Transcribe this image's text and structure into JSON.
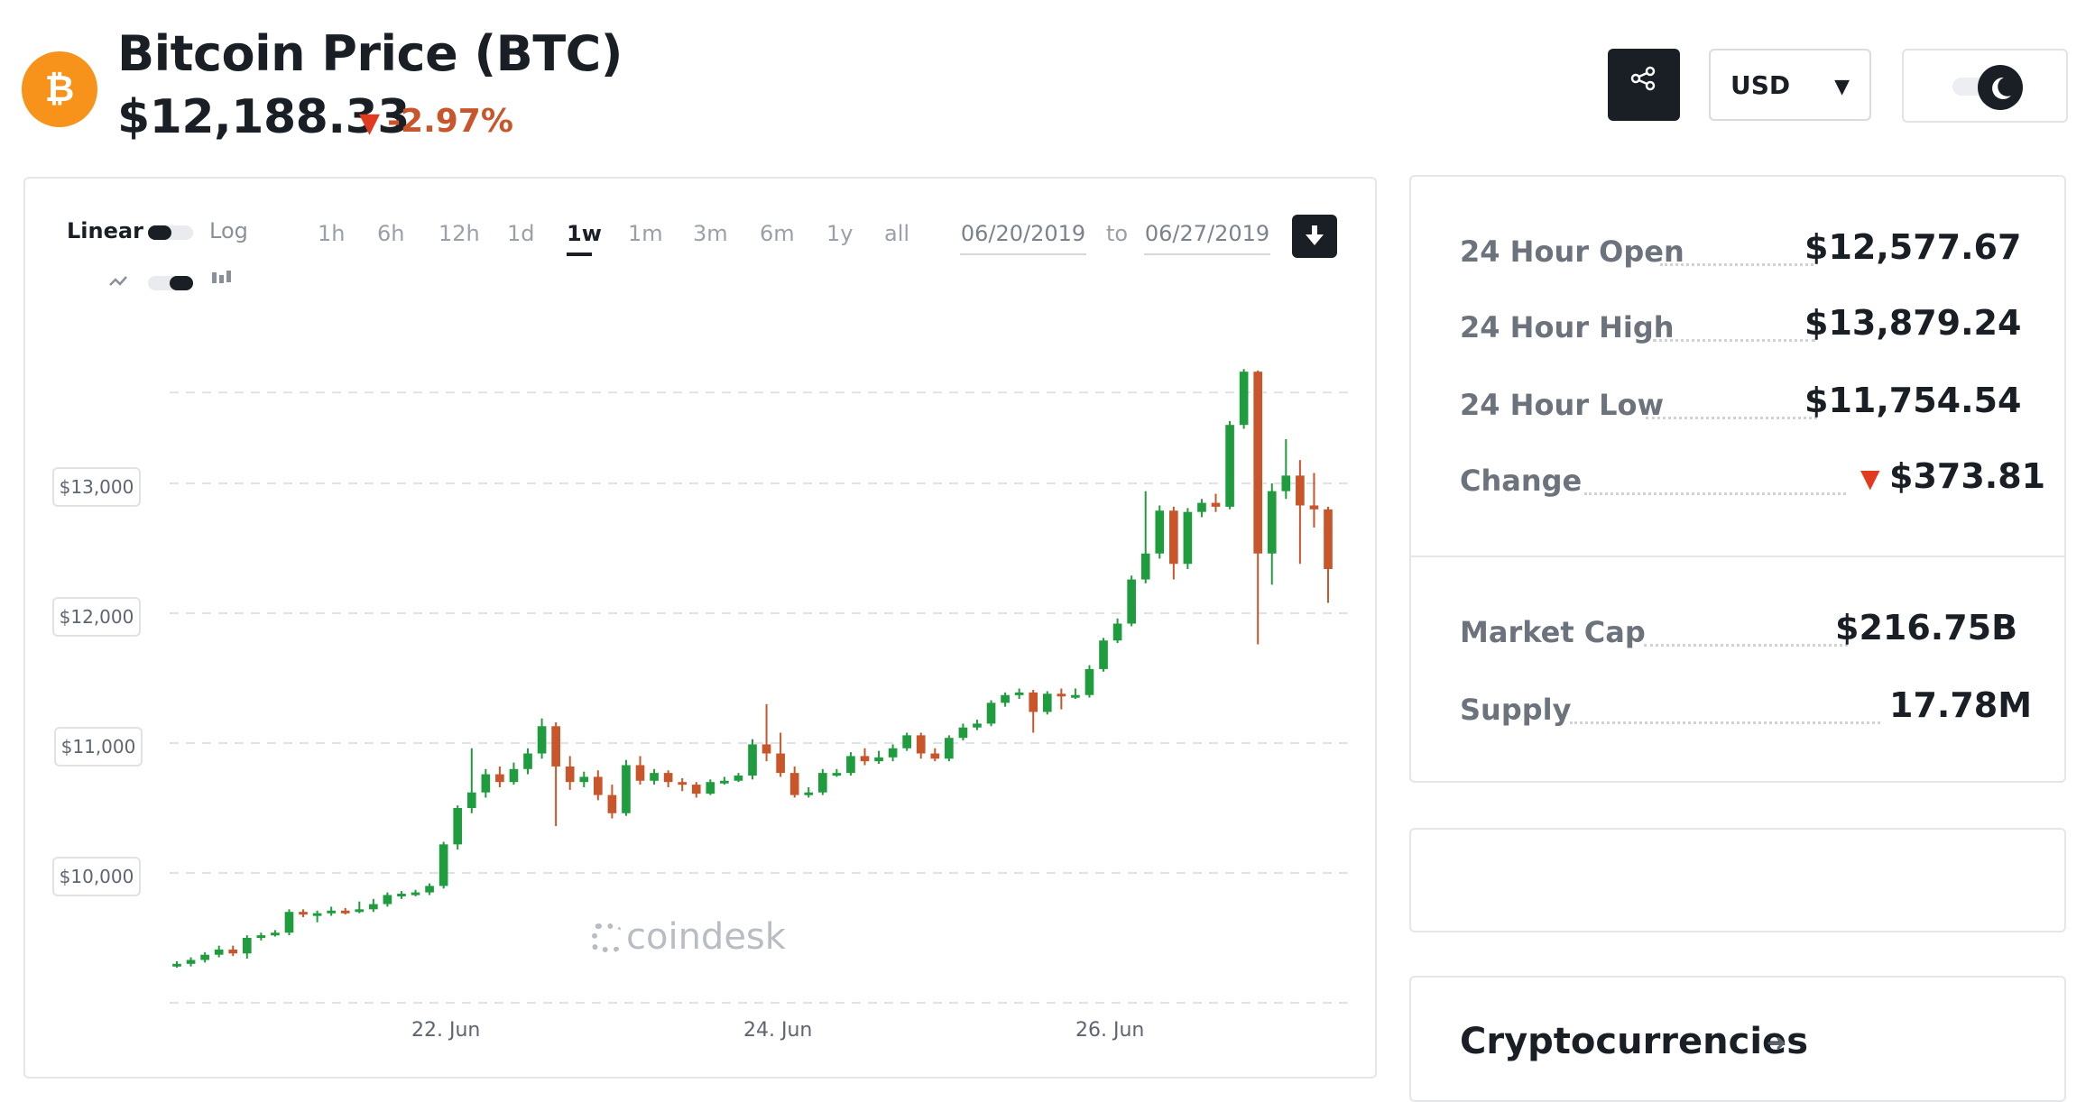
{
  "header": {
    "logo_icon": "bitcoin-logo-icon",
    "title": "Bitcoin Price (BTC)",
    "price": "$12,188.33",
    "change_pct": "-2.97%",
    "change_direction_icon": "down-triangle-icon"
  },
  "toolbar": {
    "share_icon": "share-icon",
    "currency": "USD",
    "theme_icon": "moon-icon"
  },
  "chart_controls": {
    "scale_linear": "Linear",
    "scale_log": "Log",
    "ranges": [
      "1h",
      "6h",
      "12h",
      "1d",
      "1w",
      "1m",
      "3m",
      "6m",
      "1y",
      "all"
    ],
    "active_range": "1w",
    "date_from": "06/20/2019",
    "date_to_label": "to",
    "date_to": "06/27/2019",
    "download_icon": "download-icon"
  },
  "chart_data": {
    "type": "candlestick",
    "ylabels": [
      "$13,000",
      "$12,000",
      "$11,000",
      "$10,000"
    ],
    "xlabels": [
      "22. Jun",
      "24. Jun",
      "26. Jun"
    ],
    "ylim": [
      9200,
      14200
    ],
    "up_color": "#1f9c3e",
    "down_color": "#c8562a",
    "watermark": "coindesk",
    "candles": [
      {
        "o": 9290,
        "c": 9300,
        "h": 9320,
        "l": 9270
      },
      {
        "o": 9300,
        "c": 9330,
        "h": 9350,
        "l": 9280
      },
      {
        "o": 9330,
        "c": 9370,
        "h": 9390,
        "l": 9310
      },
      {
        "o": 9370,
        "c": 9410,
        "h": 9440,
        "l": 9350
      },
      {
        "o": 9410,
        "c": 9380,
        "h": 9440,
        "l": 9360
      },
      {
        "o": 9380,
        "c": 9500,
        "h": 9520,
        "l": 9340
      },
      {
        "o": 9500,
        "c": 9520,
        "h": 9540,
        "l": 9480
      },
      {
        "o": 9520,
        "c": 9540,
        "h": 9560,
        "l": 9510
      },
      {
        "o": 9540,
        "c": 9700,
        "h": 9720,
        "l": 9520
      },
      {
        "o": 9700,
        "c": 9680,
        "h": 9720,
        "l": 9660
      },
      {
        "o": 9680,
        "c": 9690,
        "h": 9710,
        "l": 9620
      },
      {
        "o": 9690,
        "c": 9710,
        "h": 9740,
        "l": 9670
      },
      {
        "o": 9710,
        "c": 9700,
        "h": 9730,
        "l": 9680
      },
      {
        "o": 9700,
        "c": 9720,
        "h": 9780,
        "l": 9690
      },
      {
        "o": 9720,
        "c": 9760,
        "h": 9800,
        "l": 9700
      },
      {
        "o": 9760,
        "c": 9830,
        "h": 9850,
        "l": 9740
      },
      {
        "o": 9830,
        "c": 9840,
        "h": 9860,
        "l": 9800
      },
      {
        "o": 9840,
        "c": 9850,
        "h": 9870,
        "l": 9820
      },
      {
        "o": 9850,
        "c": 9900,
        "h": 9920,
        "l": 9830
      },
      {
        "o": 9900,
        "c": 10220,
        "h": 10240,
        "l": 9880
      },
      {
        "o": 10220,
        "c": 10500,
        "h": 10520,
        "l": 10180
      },
      {
        "o": 10500,
        "c": 10620,
        "h": 10960,
        "l": 10460
      },
      {
        "o": 10620,
        "c": 10760,
        "h": 10800,
        "l": 10580
      },
      {
        "o": 10760,
        "c": 10700,
        "h": 10820,
        "l": 10660
      },
      {
        "o": 10700,
        "c": 10800,
        "h": 10850,
        "l": 10680
      },
      {
        "o": 10800,
        "c": 10920,
        "h": 10960,
        "l": 10760
      },
      {
        "o": 10920,
        "c": 11130,
        "h": 11190,
        "l": 10880
      },
      {
        "o": 11130,
        "c": 10820,
        "h": 11160,
        "l": 10360
      },
      {
        "o": 10820,
        "c": 10700,
        "h": 10900,
        "l": 10640
      },
      {
        "o": 10700,
        "c": 10740,
        "h": 10780,
        "l": 10660
      },
      {
        "o": 10740,
        "c": 10600,
        "h": 10790,
        "l": 10560
      },
      {
        "o": 10600,
        "c": 10460,
        "h": 10680,
        "l": 10420
      },
      {
        "o": 10460,
        "c": 10830,
        "h": 10870,
        "l": 10440
      },
      {
        "o": 10830,
        "c": 10710,
        "h": 10900,
        "l": 10680
      },
      {
        "o": 10710,
        "c": 10770,
        "h": 10800,
        "l": 10680
      },
      {
        "o": 10770,
        "c": 10700,
        "h": 10790,
        "l": 10660
      },
      {
        "o": 10700,
        "c": 10680,
        "h": 10730,
        "l": 10630
      },
      {
        "o": 10680,
        "c": 10610,
        "h": 10700,
        "l": 10580
      },
      {
        "o": 10610,
        "c": 10700,
        "h": 10720,
        "l": 10600
      },
      {
        "o": 10700,
        "c": 10710,
        "h": 10740,
        "l": 10680
      },
      {
        "o": 10710,
        "c": 10750,
        "h": 10770,
        "l": 10700
      },
      {
        "o": 10750,
        "c": 10990,
        "h": 11030,
        "l": 10720
      },
      {
        "o": 10990,
        "c": 10920,
        "h": 11300,
        "l": 10860
      },
      {
        "o": 10920,
        "c": 10770,
        "h": 11080,
        "l": 10740
      },
      {
        "o": 10770,
        "c": 10600,
        "h": 10820,
        "l": 10580
      },
      {
        "o": 10600,
        "c": 10620,
        "h": 10660,
        "l": 10580
      },
      {
        "o": 10620,
        "c": 10770,
        "h": 10800,
        "l": 10600
      },
      {
        "o": 10770,
        "c": 10770,
        "h": 10800,
        "l": 10740
      },
      {
        "o": 10770,
        "c": 10900,
        "h": 10930,
        "l": 10750
      },
      {
        "o": 10900,
        "c": 10860,
        "h": 10960,
        "l": 10830
      },
      {
        "o": 10860,
        "c": 10890,
        "h": 10940,
        "l": 10840
      },
      {
        "o": 10890,
        "c": 10960,
        "h": 10990,
        "l": 10860
      },
      {
        "o": 10960,
        "c": 11060,
        "h": 11080,
        "l": 10940
      },
      {
        "o": 11060,
        "c": 10920,
        "h": 11080,
        "l": 10880
      },
      {
        "o": 10920,
        "c": 10880,
        "h": 10960,
        "l": 10860
      },
      {
        "o": 10880,
        "c": 11040,
        "h": 11060,
        "l": 10860
      },
      {
        "o": 11040,
        "c": 11120,
        "h": 11150,
        "l": 11020
      },
      {
        "o": 11120,
        "c": 11150,
        "h": 11180,
        "l": 11100
      },
      {
        "o": 11150,
        "c": 11310,
        "h": 11330,
        "l": 11130
      },
      {
        "o": 11310,
        "c": 11370,
        "h": 11390,
        "l": 11280
      },
      {
        "o": 11370,
        "c": 11390,
        "h": 11420,
        "l": 11340
      },
      {
        "o": 11390,
        "c": 11240,
        "h": 11410,
        "l": 11080
      },
      {
        "o": 11240,
        "c": 11380,
        "h": 11400,
        "l": 11220
      },
      {
        "o": 11380,
        "c": 11360,
        "h": 11420,
        "l": 11260
      },
      {
        "o": 11360,
        "c": 11370,
        "h": 11420,
        "l": 11340
      },
      {
        "o": 11370,
        "c": 11570,
        "h": 11600,
        "l": 11350
      },
      {
        "o": 11570,
        "c": 11790,
        "h": 11810,
        "l": 11550
      },
      {
        "o": 11790,
        "c": 11920,
        "h": 11960,
        "l": 11770
      },
      {
        "o": 11920,
        "c": 12260,
        "h": 12290,
        "l": 11900
      },
      {
        "o": 12260,
        "c": 12460,
        "h": 12940,
        "l": 12230
      },
      {
        "o": 12460,
        "c": 12790,
        "h": 12830,
        "l": 12420
      },
      {
        "o": 12790,
        "c": 12380,
        "h": 12820,
        "l": 12260
      },
      {
        "o": 12380,
        "c": 12780,
        "h": 12810,
        "l": 12340
      },
      {
        "o": 12780,
        "c": 12850,
        "h": 12880,
        "l": 12740
      },
      {
        "o": 12850,
        "c": 12820,
        "h": 12920,
        "l": 12780
      },
      {
        "o": 12820,
        "c": 13450,
        "h": 13480,
        "l": 12800
      },
      {
        "o": 13450,
        "c": 13860,
        "h": 13880,
        "l": 13420
      },
      {
        "o": 13860,
        "c": 12460,
        "h": 13870,
        "l": 11760
      },
      {
        "o": 12460,
        "c": 12940,
        "h": 13000,
        "l": 12220
      },
      {
        "o": 12940,
        "c": 13060,
        "h": 13340,
        "l": 12880
      },
      {
        "o": 13060,
        "c": 12830,
        "h": 13180,
        "l": 12380
      },
      {
        "o": 12830,
        "c": 12800,
        "h": 13080,
        "l": 12660
      },
      {
        "o": 12800,
        "c": 12340,
        "h": 12820,
        "l": 12080
      }
    ]
  },
  "stats": {
    "rows": [
      {
        "label": "24 Hour Open",
        "value": "$12,577.67"
      },
      {
        "label": "24 Hour High",
        "value": "$13,879.24"
      },
      {
        "label": "24 Hour Low",
        "value": "$11,754.54"
      },
      {
        "label": "Change",
        "value": "$373.81"
      }
    ],
    "rows2": [
      {
        "label": "Market Cap",
        "value": "$216.75B"
      },
      {
        "label": "Supply",
        "value": "17.78M"
      }
    ]
  },
  "cryptocurrencies": {
    "title": "Cryptocurrencies"
  }
}
